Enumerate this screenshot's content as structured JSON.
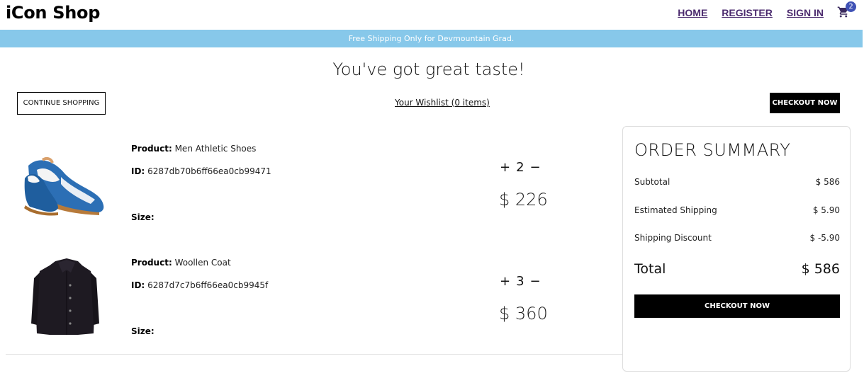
{
  "nav": {
    "logo": "iCon Shop",
    "links": [
      "HOME",
      "REGISTER",
      "SIGN IN"
    ],
    "cart_count": "2"
  },
  "banner": "Free Shipping Only for Devmountain Grad.",
  "heading": "You've got great taste!",
  "actions": {
    "continue_label": "CONTINUE SHOPPING",
    "wishlist_label": "Your Wishlist (0 items)",
    "checkout_label": "CHECKOUT NOW"
  },
  "cart": {
    "items": [
      {
        "product_label": "Product:",
        "product": "Men Athletic Shoes",
        "id_label": "ID:",
        "id": "6287db70b6ff66ea0cb99471",
        "size_label": "Size:",
        "plus": "+",
        "quantity": "2",
        "minus": "−",
        "price": "$ 226"
      },
      {
        "product_label": "Product:",
        "product": "Woollen Coat",
        "id_label": "ID:",
        "id": "6287d7c7b6ff66ea0cb9945f",
        "size_label": "Size:",
        "plus": "+",
        "quantity": "3",
        "minus": "−",
        "price": "$ 360"
      }
    ]
  },
  "summary": {
    "title": "ORDER SUMMARY",
    "subtotal_label": "Subtotal",
    "subtotal": "$ 586",
    "shipping_label": "Estimated Shipping",
    "shipping": "$ 5.90",
    "discount_label": "Shipping Discount",
    "discount": "$ -5.90",
    "total_label": "Total",
    "total": "$ 586",
    "checkout_label": "CHECKOUT NOW"
  },
  "colors": {
    "banner": "#87c8ea",
    "nav_link": "#4b2a6e",
    "badge": "#3f51b5"
  }
}
